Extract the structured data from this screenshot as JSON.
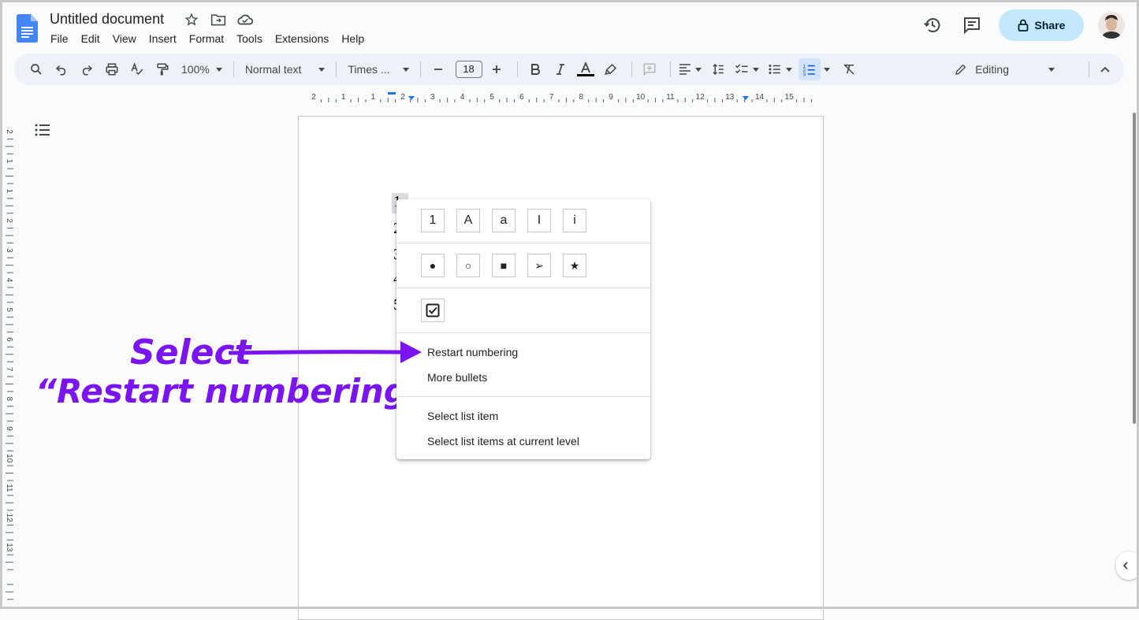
{
  "app": {
    "doc_title": "Untitled document",
    "menus": [
      "File",
      "Edit",
      "View",
      "Insert",
      "Format",
      "Tools",
      "Extensions",
      "Help"
    ],
    "share_label": "Share",
    "title_icons": [
      "star-icon",
      "move-to-folder-icon",
      "cloud-saved-icon"
    ],
    "header_icons": [
      "version-history-icon",
      "comments-icon",
      "lock-icon"
    ]
  },
  "toolbar": {
    "zoom": "100%",
    "style": "Normal text",
    "font": "Times ...",
    "font_size": "18",
    "mode": "Editing",
    "text_color": "#000000",
    "icons": [
      "search-icon",
      "undo-icon",
      "redo-icon",
      "print-icon",
      "spellcheck-icon",
      "paint-format-icon",
      "bold-icon",
      "italic-icon",
      "text-color-icon",
      "highlight-icon",
      "insert-comment-icon",
      "align-icon",
      "line-spacing-icon",
      "checklist-icon",
      "bulleted-list-icon",
      "numbered-list-icon",
      "clear-formatting-icon",
      "pencil-icon",
      "collapse-icon"
    ]
  },
  "ruler": {
    "top_labels": [
      "2",
      "1",
      "1",
      "2",
      "3",
      "4",
      "5",
      "6",
      "7",
      "8",
      "9",
      "10",
      "11",
      "12",
      "13",
      "14",
      "15"
    ],
    "left_labels": [
      "2",
      "1",
      "1",
      "2",
      "3",
      "4",
      "5",
      "6",
      "7",
      "8",
      "9",
      "10",
      "11",
      "12",
      "13"
    ]
  },
  "document": {
    "list_numbers": [
      "1",
      "2",
      "3",
      "4",
      "5"
    ]
  },
  "list_menu": {
    "numbering_options": [
      "1",
      "A",
      "a",
      "I",
      "i"
    ],
    "bullet_options": [
      "●",
      "○",
      "■",
      "➢",
      "★"
    ],
    "checkbox_option": "☑",
    "items": {
      "restart": "Restart numbering",
      "more_bullets": "More bullets",
      "select_item": "Select list item",
      "select_level": "Select list items at current level"
    }
  },
  "annotation": {
    "line1": "Select",
    "line2": "“Restart numbering”",
    "color": "#7a14f0"
  }
}
